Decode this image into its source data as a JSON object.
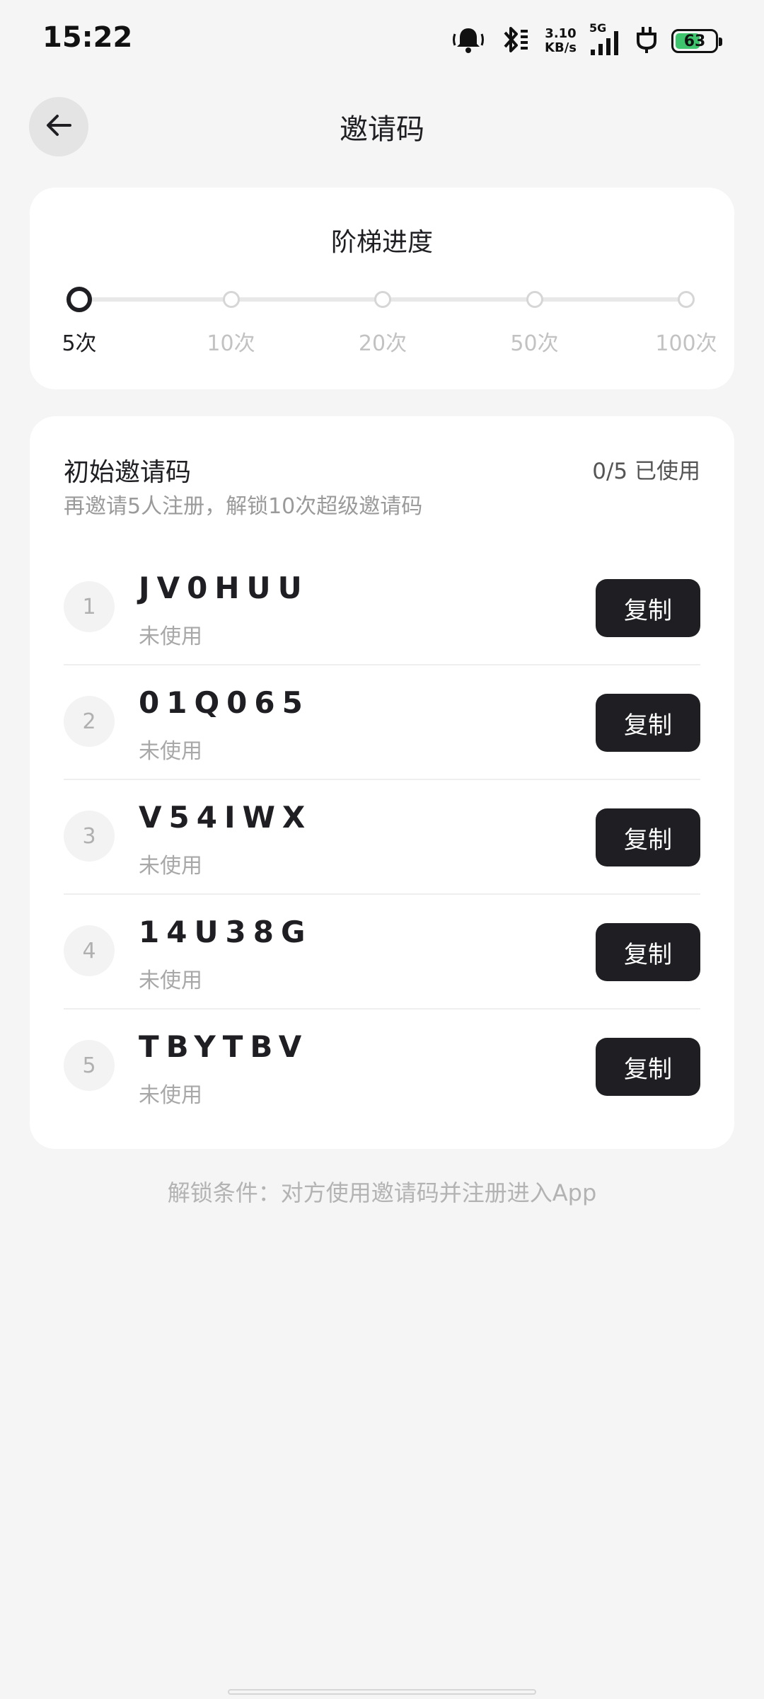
{
  "status_bar": {
    "time": "15:22",
    "net_speed_value": "3.10",
    "net_speed_unit": "KB/s",
    "network_type": "5G",
    "battery_level": "63",
    "battery_fraction": 0.63
  },
  "header": {
    "title": "邀请码"
  },
  "progress": {
    "title": "阶梯进度",
    "steps": [
      {
        "label": "5次",
        "active": true
      },
      {
        "label": "10次",
        "active": false
      },
      {
        "label": "20次",
        "active": false
      },
      {
        "label": "50次",
        "active": false
      },
      {
        "label": "100次",
        "active": false
      }
    ]
  },
  "codes": {
    "title": "初始邀请码",
    "usage": "0/5 已使用",
    "subtitle": "再邀请5人注册，解锁10次超级邀请码",
    "items": [
      {
        "index": "1",
        "code": "JV0HUU",
        "status": "未使用",
        "copy_label": "复制"
      },
      {
        "index": "2",
        "code": "01Q065",
        "status": "未使用",
        "copy_label": "复制"
      },
      {
        "index": "3",
        "code": "V54IWX",
        "status": "未使用",
        "copy_label": "复制"
      },
      {
        "index": "4",
        "code": "14U38G",
        "status": "未使用",
        "copy_label": "复制"
      },
      {
        "index": "5",
        "code": "TBYTBV",
        "status": "未使用",
        "copy_label": "复制"
      }
    ]
  },
  "footer": {
    "unlock_note": "解锁条件：对方使用邀请码并注册进入App"
  },
  "colors": {
    "background": "#f5f5f5",
    "card": "#ffffff",
    "accent_dark": "#1f1f23",
    "muted_text": "#9a9a9a"
  }
}
